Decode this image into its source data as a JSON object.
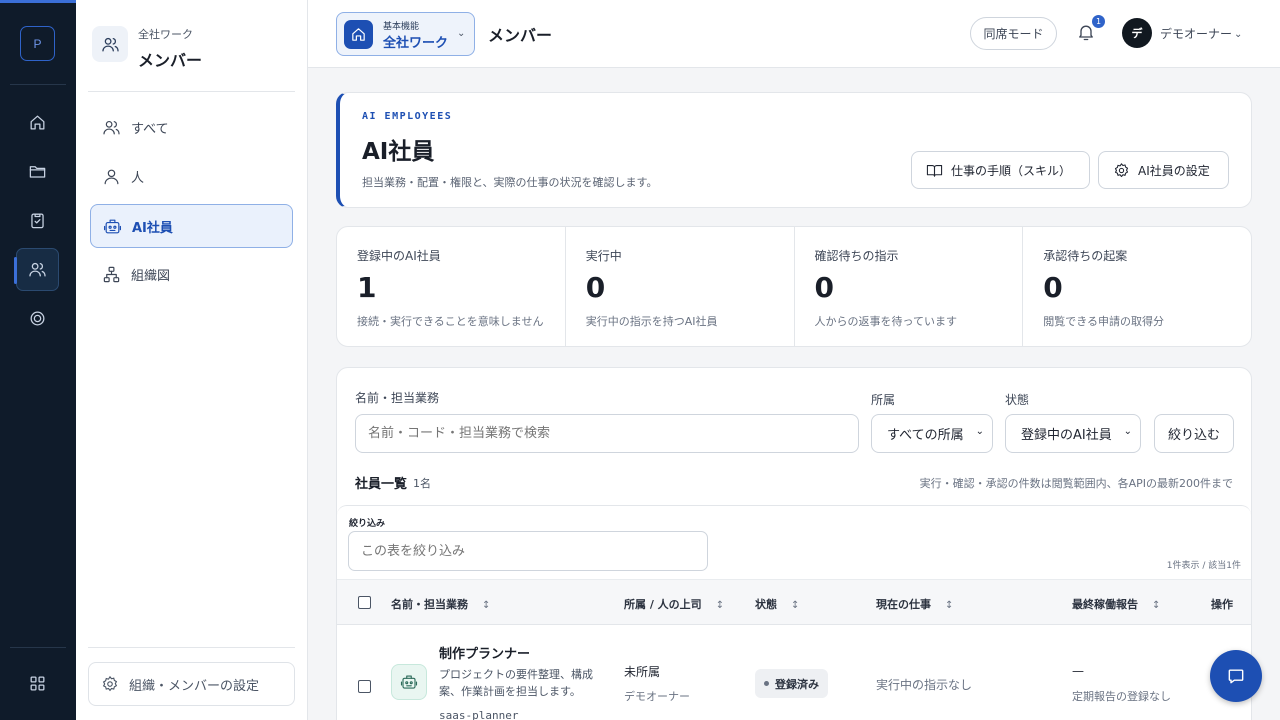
{
  "rail": {
    "logo": "P",
    "items": [
      "home-icon",
      "folder-icon",
      "clipboard-check-icon",
      "users-icon",
      "settings-target-icon"
    ],
    "apps_icon": "grid-icon"
  },
  "sidebar": {
    "sup": "全社ワーク",
    "title": "メンバー",
    "items": [
      {
        "label": "すべて",
        "icon": "users-icon"
      },
      {
        "label": "人",
        "icon": "user-icon"
      },
      {
        "label": "AI社員",
        "icon": "robot-icon"
      },
      {
        "label": "組織図",
        "icon": "org-chart-icon"
      }
    ],
    "settings_label": "組織・メンバーの設定"
  },
  "header": {
    "workspace_sup": "基本機能",
    "workspace_name": "全社ワーク",
    "page_title": "メンバー",
    "presence_label": "同席モード",
    "notif_count": "1",
    "avatar_initial": "デ",
    "user_name": "デモオーナー"
  },
  "hero": {
    "eyebrow": "AI EMPLOYEES",
    "title": "AI社員",
    "subtitle": "担当業務・配置・権限と、実際の仕事の状況を確認します。",
    "skills_button": "仕事の手順（スキル）",
    "settings_button": "AI社員の設定"
  },
  "stats": [
    {
      "label": "登録中のAI社員",
      "value": "1",
      "note": "接続・実行できることを意味しません"
    },
    {
      "label": "実行中",
      "value": "0",
      "note": "実行中の指示を持つAI社員"
    },
    {
      "label": "確認待ちの指示",
      "value": "0",
      "note": "人からの返事を待っています"
    },
    {
      "label": "承認待ちの起案",
      "value": "0",
      "note": "閲覧できる申請の取得分"
    }
  ],
  "filters": {
    "search_label": "名前・担当業務",
    "search_placeholder": "名前・コード・担当業務で検索",
    "dept_label": "所属",
    "dept_value": "すべての所属",
    "status_label": "状態",
    "status_value": "登録中のAI社員",
    "apply_button": "絞り込む"
  },
  "list": {
    "title": "社員一覧",
    "count": "1名",
    "note": "実行・確認・承認の件数は閲覧範囲内、各APIの最新200件まで",
    "table_filter_label": "絞り込み",
    "table_filter_placeholder": "この表を絞り込み",
    "shown_count": "1件表示 / 該当1件",
    "columns": [
      "名前・担当業務",
      "所属 / 人の上司",
      "状態",
      "現在の仕事",
      "最終稼働報告",
      "操作"
    ],
    "sort_glyph": "↕",
    "rows": [
      {
        "name": "制作プランナー",
        "description": "プロジェクトの要件整理、構成案、作業計画を担当します。",
        "code": "saas-planner",
        "dept": "未所属",
        "supervisor": "デモオーナー",
        "status": "登録済み",
        "current_job": "実行中の指示なし",
        "last_report": "—",
        "last_report_note": "定期報告の登録なし"
      }
    ]
  }
}
